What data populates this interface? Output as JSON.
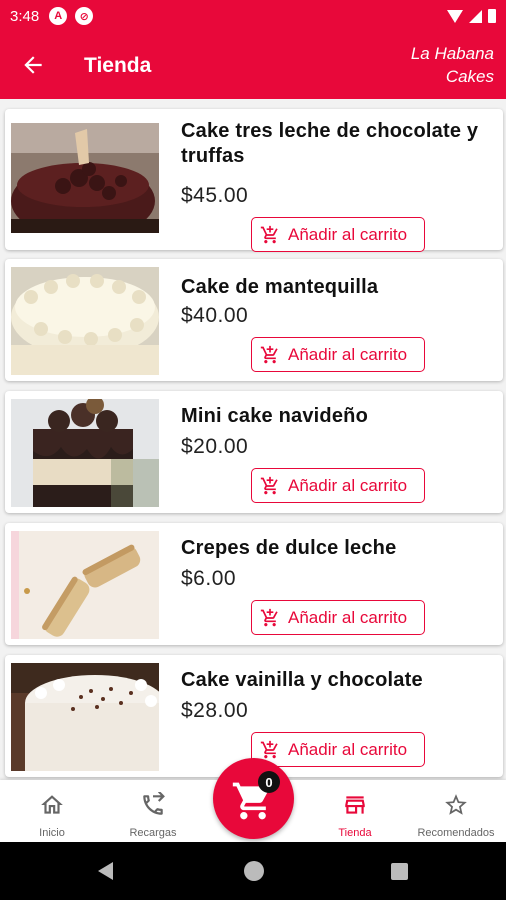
{
  "status_bar": {
    "time": "3:48"
  },
  "app_bar": {
    "title": "Tienda",
    "brand_line1": "La Habana",
    "brand_line2": "Cakes"
  },
  "add_to_cart_label": "Añadir al carrito",
  "products": [
    {
      "name": "Cake tres leche de chocolate y truffas",
      "price": "$45.00"
    },
    {
      "name": "Cake de mantequilla",
      "price": "$40.00"
    },
    {
      "name": "Mini cake navideño",
      "price": "$20.00"
    },
    {
      "name": "Crepes de dulce leche",
      "price": "$6.00"
    },
    {
      "name": "Cake vainilla y chocolate",
      "price": "$28.00"
    }
  ],
  "cart": {
    "count": "0"
  },
  "bottom_nav": [
    {
      "label": "Inicio",
      "icon": "home-icon"
    },
    {
      "label": "Recargas",
      "icon": "phone-transfer-icon"
    },
    {
      "label": "Tienda",
      "icon": "store-icon",
      "active": true
    },
    {
      "label": "Recomendados",
      "icon": "star-icon"
    }
  ],
  "colors": {
    "primary": "#e8083a",
    "background": "#f2f2f2"
  }
}
